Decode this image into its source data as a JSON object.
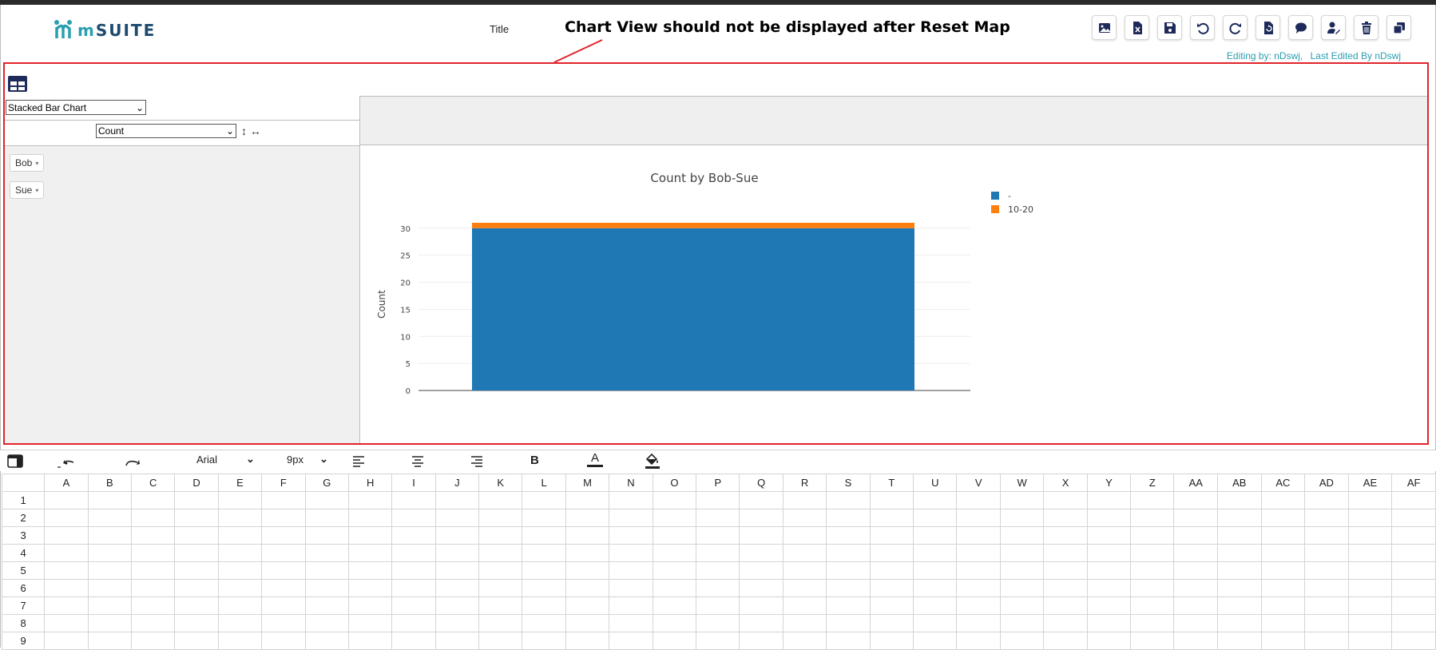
{
  "app": {
    "logo_m": "m",
    "logo_suite": "SUITE",
    "title": "Title",
    "annotation": "Chart View should not be displayed after Reset Map",
    "editing_by": "Editing by: nDswj,",
    "last_edited_by": "Last Edited By nDswj"
  },
  "toolbar": {
    "buttons": [
      "image-export-icon",
      "excel-export-icon",
      "save-icon",
      "undo-icon",
      "redo-icon",
      "reset-map-icon",
      "comment-icon",
      "edit-user-icon",
      "delete-icon",
      "copy-icon"
    ]
  },
  "pivot": {
    "chart_type": "Stacked Bar Chart",
    "aggregator": "Count",
    "row_fields": [
      "Bob",
      "Sue"
    ]
  },
  "chart_data": {
    "type": "bar",
    "stacked": true,
    "title": "Count by Bob-Sue",
    "xlabel": "",
    "ylabel": "Count",
    "ylim": [
      0,
      31
    ],
    "yticks": [
      0,
      5,
      10,
      15,
      20,
      25,
      30
    ],
    "categories": [
      ""
    ],
    "series": [
      {
        "name": "-",
        "values": [
          30
        ],
        "color": "#1f77b4"
      },
      {
        "name": "10-20",
        "values": [
          1
        ],
        "color": "#ff7f0e"
      }
    ],
    "legend_position": "top-right"
  },
  "format_bar": {
    "font": "Arial",
    "size": "9px",
    "bold": "B",
    "text_color": "A"
  },
  "sheet": {
    "columns": [
      "A",
      "B",
      "C",
      "D",
      "E",
      "F",
      "G",
      "H",
      "I",
      "J",
      "K",
      "L",
      "M",
      "N",
      "O",
      "P",
      "Q",
      "R",
      "S",
      "T",
      "U",
      "V",
      "W",
      "X",
      "Y",
      "Z",
      "AA",
      "AB",
      "AC",
      "AD",
      "AE",
      "AF"
    ],
    "rows": [
      "1",
      "2",
      "3",
      "4",
      "5",
      "6",
      "7",
      "8",
      "9"
    ]
  }
}
